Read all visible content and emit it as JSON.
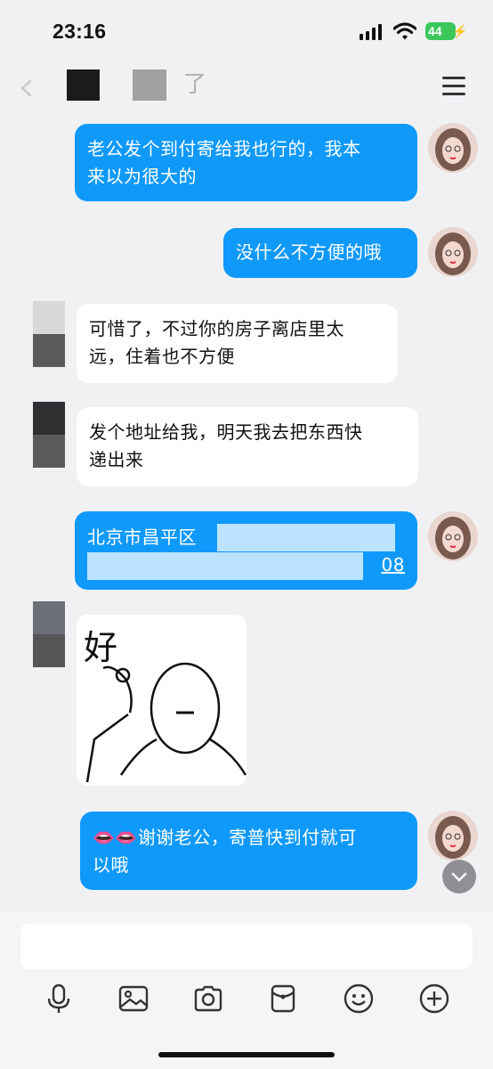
{
  "status_bar": {
    "time": "23:16",
    "battery": "44"
  },
  "nav": {
    "title_char": "了"
  },
  "messages": [
    {
      "side": "out",
      "text_lines": [
        "老公发个到付寄给我也行的，我本",
        "来以为很大的"
      ]
    },
    {
      "side": "out",
      "text_lines": [
        "没什么不方便的哦"
      ]
    },
    {
      "side": "in",
      "text_lines": [
        "可惜了，不过你的房子离店里太",
        "远，住着也不方便"
      ]
    },
    {
      "side": "in",
      "text_lines": [
        "发个地址给我，明天我去把东西快",
        "递出来"
      ]
    },
    {
      "side": "out",
      "text_lines": [
        "北京市昌平区",
        "08"
      ]
    },
    {
      "side": "in",
      "sticker_text": "好"
    },
    {
      "side": "out",
      "text_lines": [
        "谢谢老公，寄普快到付就可",
        "以哦"
      ]
    }
  ],
  "input": {
    "placeholder": ""
  },
  "toolbar": {
    "icons": [
      "microphone-icon",
      "image-icon",
      "camera-icon",
      "red-packet-icon",
      "emoji-icon",
      "plus-icon"
    ]
  },
  "colors": {
    "outgoing_bubble": "#0f99fa",
    "incoming_bubble": "#ffffff",
    "background": "#f1f1f4"
  }
}
